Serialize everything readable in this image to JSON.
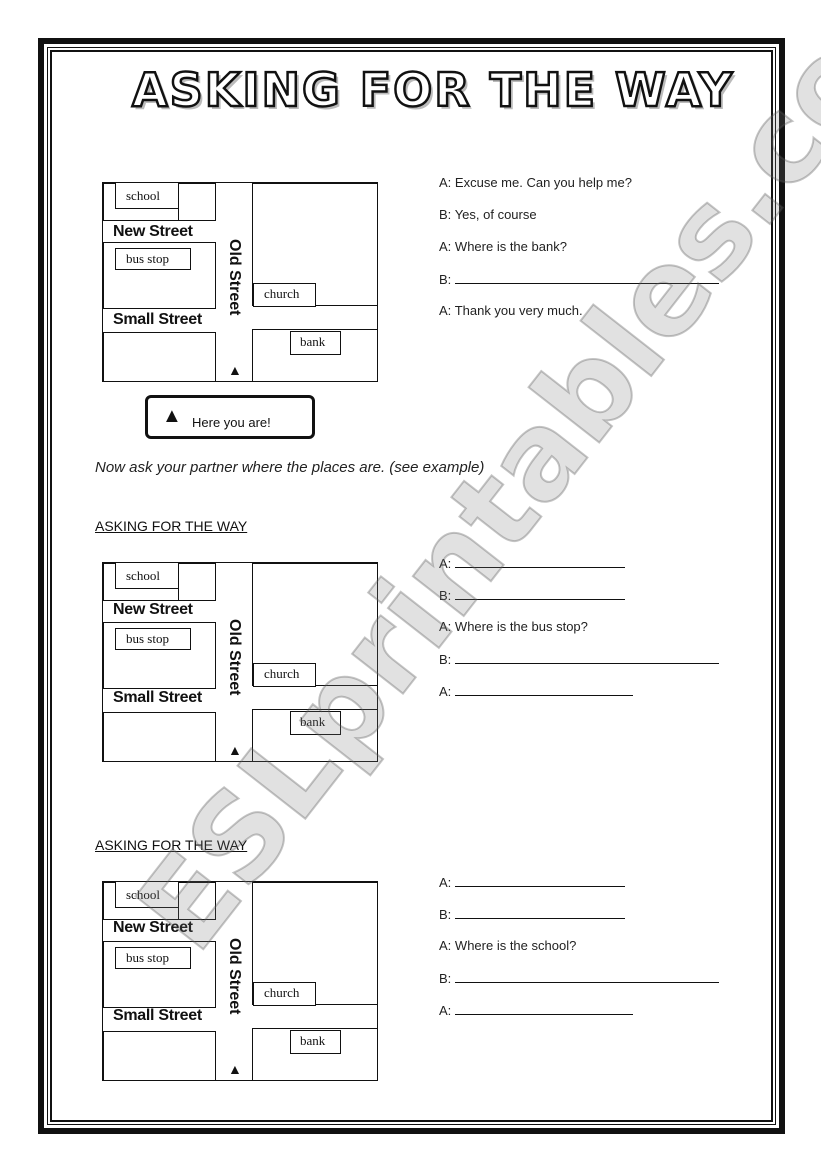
{
  "title": "ASKING FOR THE WAY",
  "watermark": "ESLprintables.com",
  "map_labels": {
    "school": "school",
    "bus_stop": "bus stop",
    "church": "church",
    "bank": "bank",
    "new_street": "New Street",
    "small_street": "Small Street",
    "old_street": "Old Street",
    "you_are_here_marker": "▲"
  },
  "legend": {
    "marker": "▲",
    "text": "Here you are!"
  },
  "instruction": "Now ask your partner where the places are. (see example)",
  "example_dialog": [
    {
      "speaker": "A:",
      "text": "Excuse me. Can you help me?"
    },
    {
      "speaker": "B:",
      "text": "Yes, of course"
    },
    {
      "speaker": "A:",
      "text": "Where is the bank?"
    },
    {
      "speaker": "B:",
      "text": ""
    },
    {
      "speaker": "A:",
      "text": "Thank you very much."
    }
  ],
  "exercises": [
    {
      "heading": "ASKING FOR THE WAY",
      "dialog": [
        {
          "speaker": "A:",
          "text": ""
        },
        {
          "speaker": "B:",
          "text": ""
        },
        {
          "speaker": "A:",
          "text": "Where is the bus stop?"
        },
        {
          "speaker": "B:",
          "text": ""
        },
        {
          "speaker": "A:",
          "text": ""
        }
      ]
    },
    {
      "heading": "ASKING FOR THE WAY",
      "dialog": [
        {
          "speaker": "A:",
          "text": ""
        },
        {
          "speaker": "B:",
          "text": ""
        },
        {
          "speaker": "A:",
          "text": "Where is the school?"
        },
        {
          "speaker": "B:",
          "text": ""
        },
        {
          "speaker": "A:",
          "text": ""
        }
      ]
    }
  ]
}
